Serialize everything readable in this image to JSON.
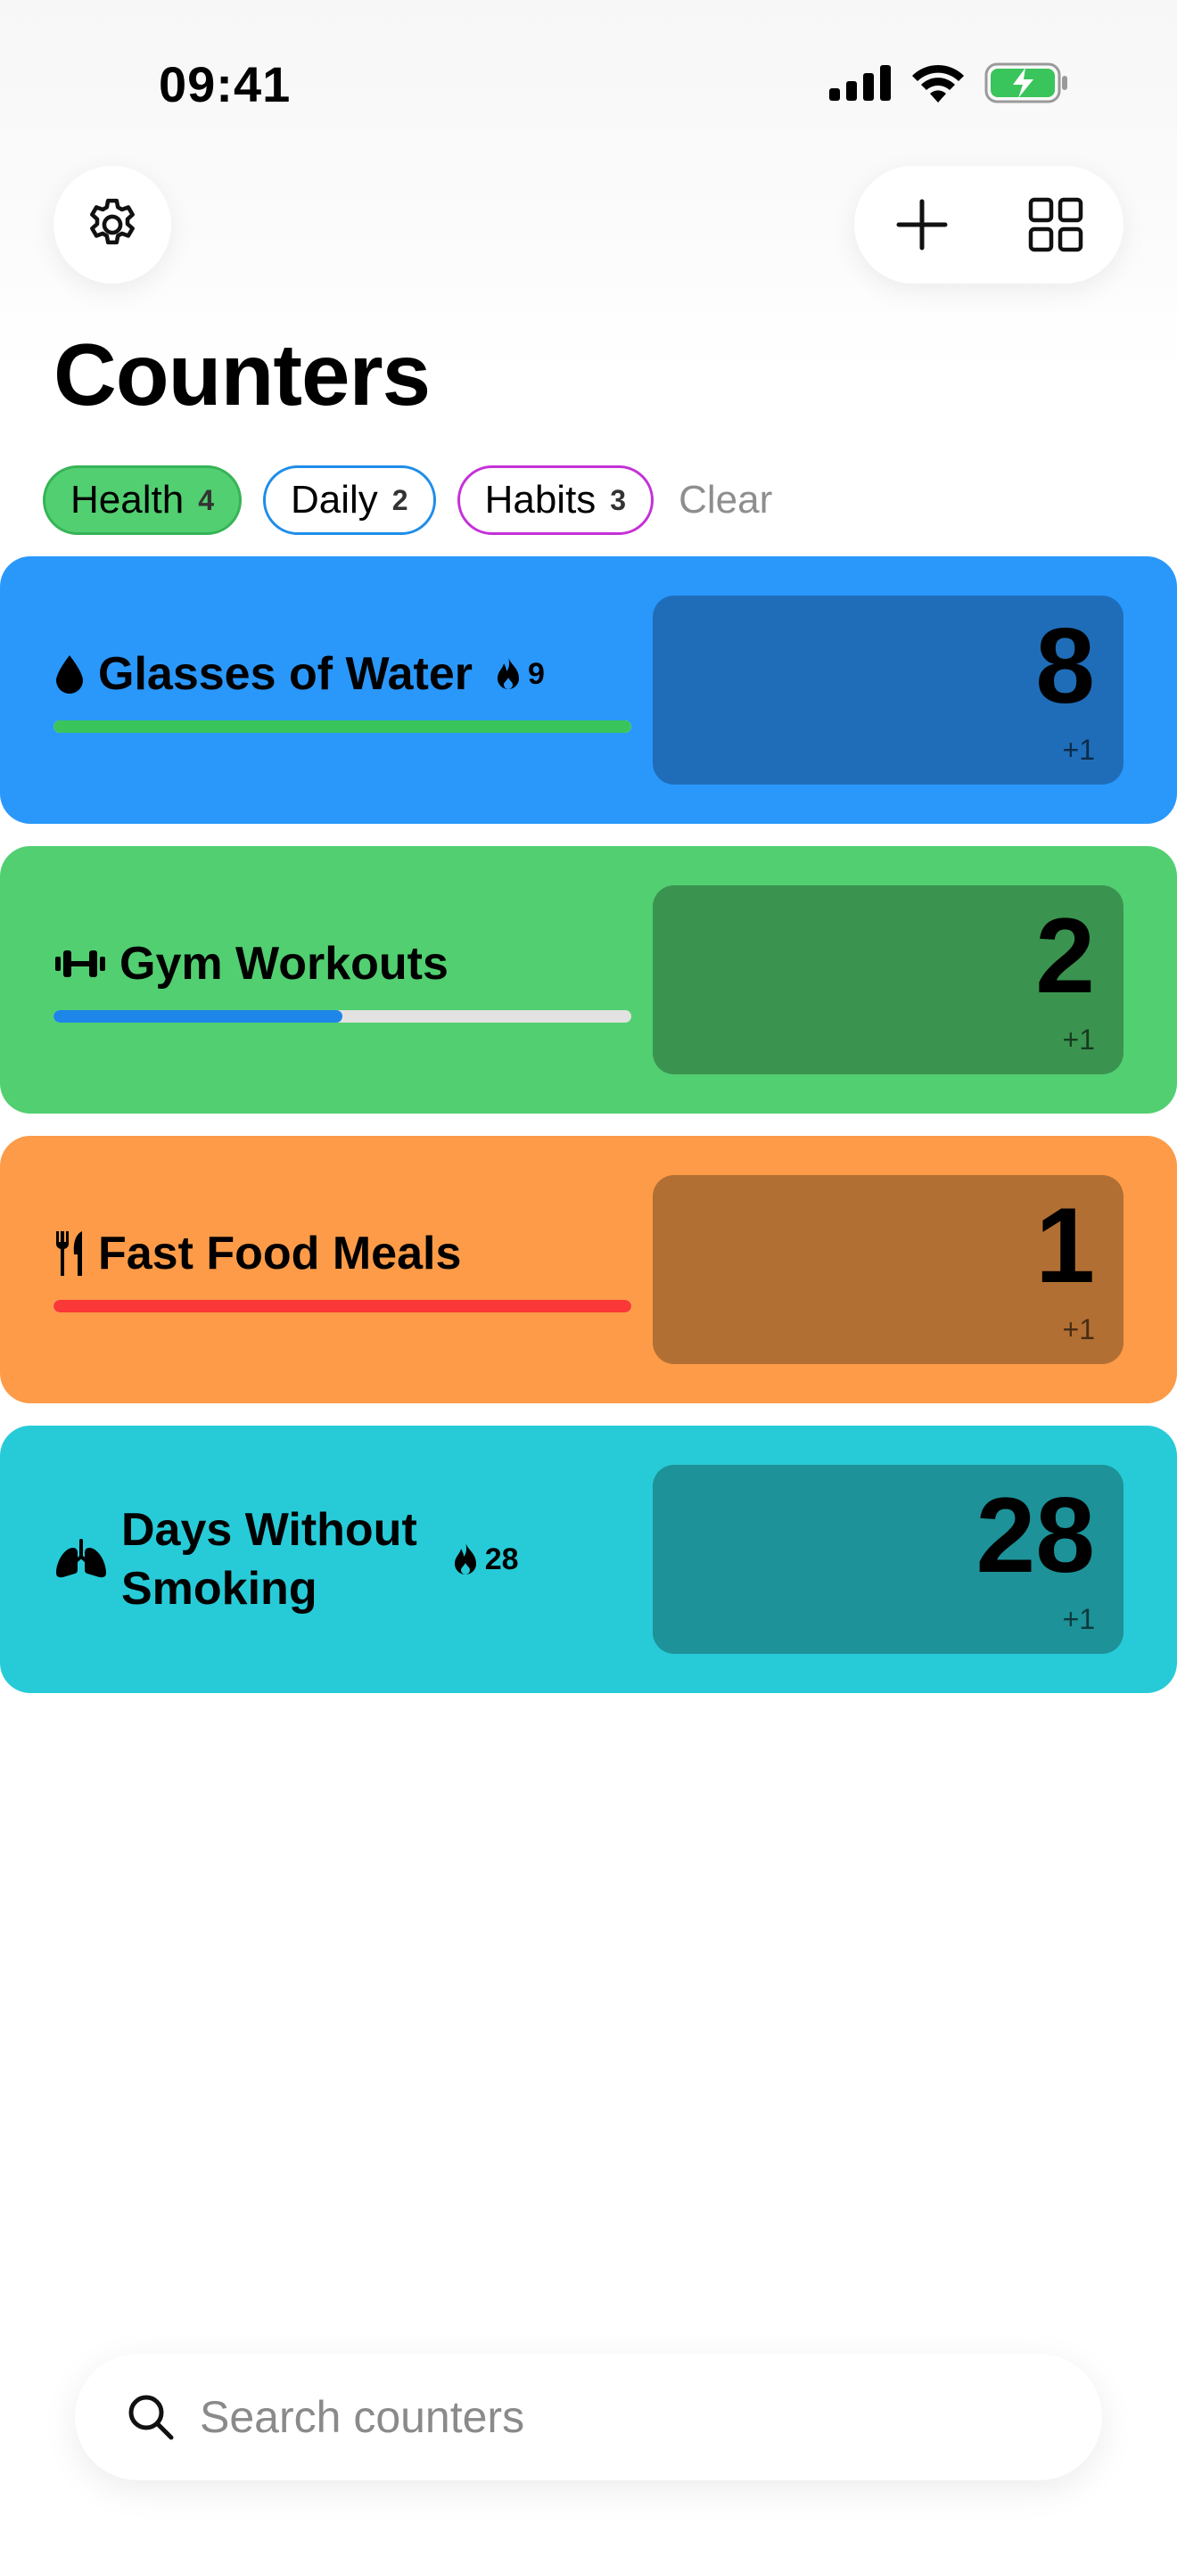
{
  "status_bar": {
    "time": "09:41"
  },
  "header": {
    "title": "Counters"
  },
  "filters": {
    "chips": [
      {
        "label": "Health",
        "count": "4"
      },
      {
        "label": "Daily",
        "count": "2"
      },
      {
        "label": "Habits",
        "count": "3"
      }
    ],
    "clear_label": "Clear"
  },
  "counters": [
    {
      "title": "Glasses of Water",
      "icon": "water-drop-icon",
      "streak": "9",
      "value": "8",
      "increment": "+1",
      "progress": 1.0,
      "card_color": "#2a98fb",
      "box_color": "#1f6db8",
      "progress_color": "#3ac45c"
    },
    {
      "title": "Gym Workouts",
      "icon": "dumbbell-icon",
      "value": "2",
      "increment": "+1",
      "progress": 0.5,
      "card_color": "#52cf71",
      "box_color": "#3a944f",
      "progress_color": "#1d86e8"
    },
    {
      "title": "Fast Food Meals",
      "icon": "fork-knife-icon",
      "value": "1",
      "increment": "+1",
      "progress": 1.0,
      "card_color": "#fd9b48",
      "box_color": "#b26f33",
      "progress_color": "#fb3838"
    },
    {
      "title_line1": "Days Without",
      "title_line2": "Smoking",
      "icon": "lungs-icon",
      "streak": "28",
      "value": "28",
      "increment": "+1",
      "card_color": "#27cbd8",
      "box_color": "#1d9298"
    }
  ],
  "search": {
    "placeholder": "Search counters"
  }
}
